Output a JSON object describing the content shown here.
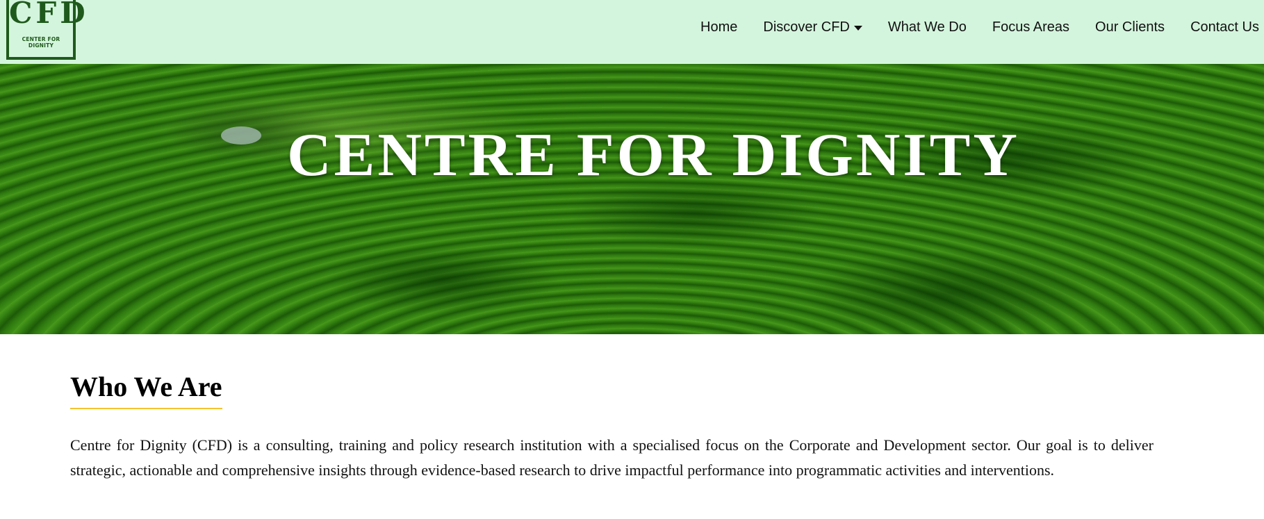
{
  "header": {
    "logo": {
      "mark": "CFD",
      "subtitle": "CENTER FOR DIGNITY"
    },
    "nav": [
      {
        "label": "Home"
      },
      {
        "label": "Discover CFD",
        "icon": "caret-down-icon"
      },
      {
        "label": "What We Do"
      },
      {
        "label": "Focus Areas"
      },
      {
        "label": "Our Clients"
      },
      {
        "label": "Contact Us"
      }
    ]
  },
  "hero": {
    "title": "CENTRE FOR DIGNITY"
  },
  "about": {
    "title": "Who We Are",
    "body": "Centre for Dignity (CFD) is a consulting, training and policy research institution with a specialised focus on the Corporate and Development sector. Our goal is to deliver strategic, actionable and comprehensive insights through evidence-based research to drive impactful performance into programmatic activities and interventions."
  },
  "colors": {
    "header_bg": "#d4f5dd",
    "logo": "#1f5a1c",
    "accent_underline": "#f4c430"
  }
}
